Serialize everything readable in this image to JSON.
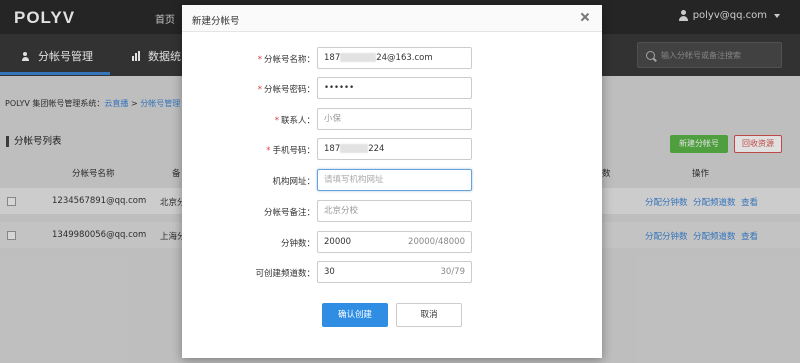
{
  "topbar": {
    "logo": "POLYV",
    "nav_home": "首页",
    "user_email": "polyv@qq.com"
  },
  "subnav": {
    "tab_accounts": "分帐号管理",
    "tab_stats": "数据统",
    "search_placeholder": "输入分帐号或备注搜索"
  },
  "breadcrumb": {
    "prefix": "POLYV 集团帐号管理系统：",
    "link1": "云直播",
    "sep": " > ",
    "link2": "分帐号管理"
  },
  "section": {
    "title": "分帐号列表",
    "new_button": "新建分帐号",
    "recycle_button": "回收资源"
  },
  "table": {
    "headers": [
      "分帐号名称",
      "备",
      "数",
      "操作"
    ],
    "rows": [
      {
        "name": "1234567891@qq.com",
        "note": "北京分",
        "actions": [
          "分配分钟数",
          "分配频道数",
          "查看"
        ]
      },
      {
        "name": "1349980056@qq.com",
        "note": "上海分",
        "actions": [
          "分配分钟数",
          "分配频道数",
          "查看"
        ]
      }
    ]
  },
  "modal": {
    "title": "新建分帐号",
    "fields": [
      {
        "label": "分帐号名称：",
        "required": true,
        "value_prefix": "187",
        "value_suffix": "24@163.com"
      },
      {
        "label": "分帐号密码：",
        "required": true,
        "value": "••••••"
      },
      {
        "label": "联系人：",
        "required": true,
        "value": "小保"
      },
      {
        "label": "手机号码：",
        "required": true,
        "value_prefix": "187",
        "value_suffix": "224"
      },
      {
        "label": "机构网址：",
        "required": false,
        "placeholder": "请填写机构网址"
      },
      {
        "label": "分帐号备注：",
        "required": false,
        "value": "北京分校"
      },
      {
        "label": "分钟数：",
        "required": false,
        "value": "20000",
        "counter": "20000/48000"
      },
      {
        "label": "可创建频道数：",
        "required": false,
        "value": "30",
        "counter": "30/79"
      }
    ],
    "confirm_button": "确认创建",
    "cancel_button": "取消"
  }
}
